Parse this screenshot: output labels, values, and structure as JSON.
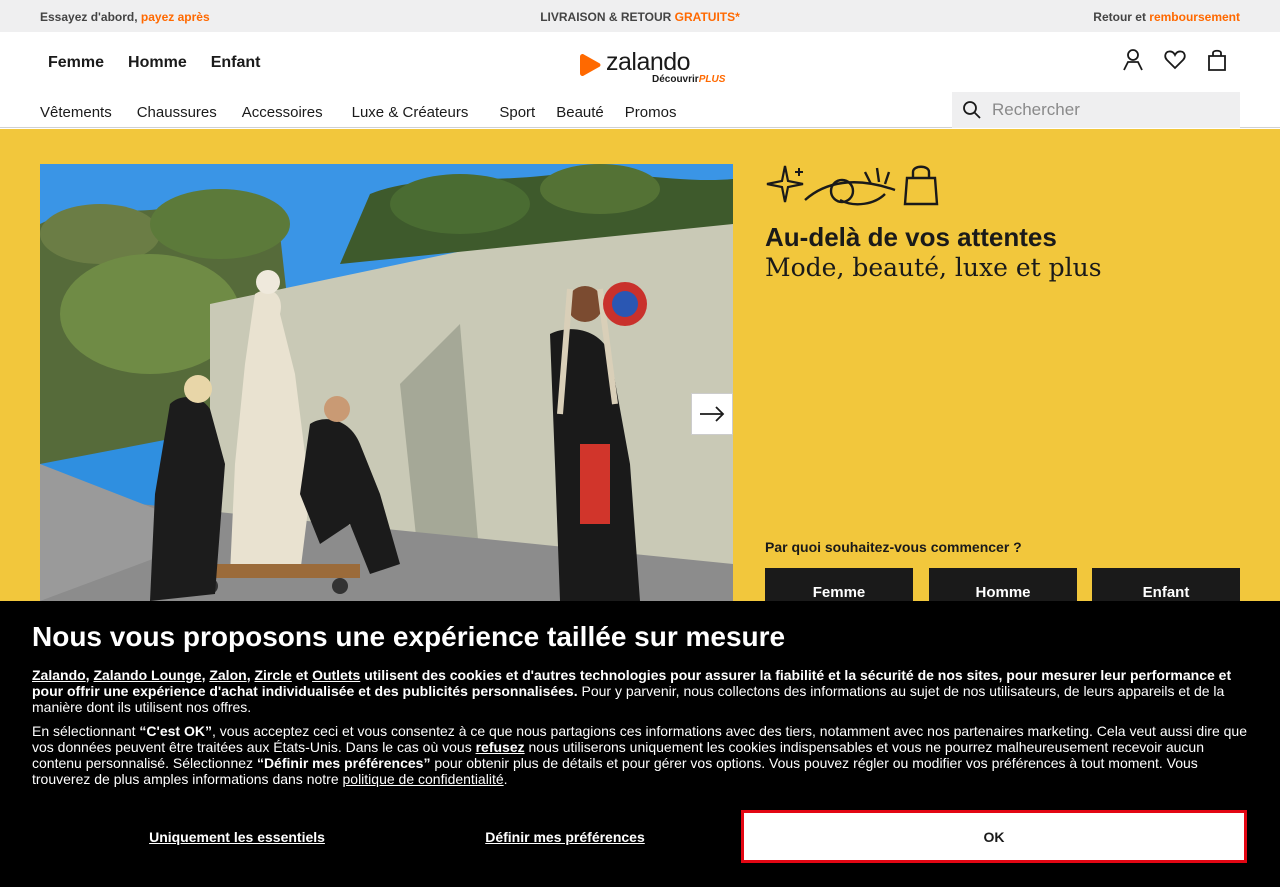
{
  "promo": {
    "left_prefix": "Essayez d'abord,",
    "left_highlight": "payez après",
    "center_prefix": "LIVRAISON & RETOUR",
    "center_highlight": "GRATUITS*",
    "right_prefix": "Retour et",
    "right_highlight": "remboursement"
  },
  "header": {
    "genders": [
      "Femme",
      "Homme",
      "Enfant"
    ],
    "logo_word": "zalando",
    "logo_sub": "Découvrir",
    "logo_sub_plus": "PLUS",
    "categories": [
      "Vêtements",
      "Chaussures",
      "Accessoires",
      "Luxe & Créateurs",
      "Sport",
      "Beauté",
      "Promos"
    ],
    "search_placeholder": "Rechercher",
    "icons": [
      "user-icon",
      "heart-icon",
      "bag-icon",
      "search-icon"
    ]
  },
  "hero": {
    "title": "Au-delà de vos attentes",
    "subtitle": "Mode, beauté, luxe et plus",
    "question": "Par quoi souhaitez-vous commencer ?",
    "buttons": [
      "Femme",
      "Homme",
      "Enfant"
    ],
    "background_color": "#f2c73c"
  },
  "cookie": {
    "title": "Nous vous proposons une expérience taillée sur mesure",
    "brands": [
      "Zalando",
      "Zalando Lounge",
      "Zalon",
      "Zircle",
      "Outlets"
    ],
    "and": "et",
    "p1_bold": "utilisent des cookies et d'autres technologies pour assurer la fiabilité et la sécurité de nos sites, pour mesurer leur performance et pour offrir une expérience d'achat individualisée et des publicités personnalisées.",
    "p1_rest": "Pour y parvenir, nous collectons des informations au sujet de nos utilisateurs, de leurs appareils et de la manière dont ils utilisent nos offres.",
    "p2_a": "En sélectionnant",
    "p2_ok": "“C'est OK”",
    "p2_b": ", vous acceptez ceci et vous consentez à ce que nous partagions ces informations avec des tiers, notamment avec nos partenaires marketing. Cela veut aussi dire que vos données peuvent être traitées aux États-Unis. Dans le cas où vous",
    "p2_refuse": "refusez",
    "p2_c": "nous utiliserons uniquement les cookies indispensables et vous ne pourrez malheureusement recevoir aucun contenu personnalisé. Sélectionnez",
    "p2_prefs": "“Définir mes préférences”",
    "p2_d": "pour obtenir plus de détails et pour gérer vos options. Vous pouvez régler ou modifier vos préférences à tout moment. Vous trouverez de plus amples informations dans notre",
    "p2_policy": "politique de confidentialité",
    "p2_end": ".",
    "btn_essentials": "Uniquement les essentiels",
    "btn_prefs": "Définir mes préférences",
    "btn_ok": "OK"
  }
}
